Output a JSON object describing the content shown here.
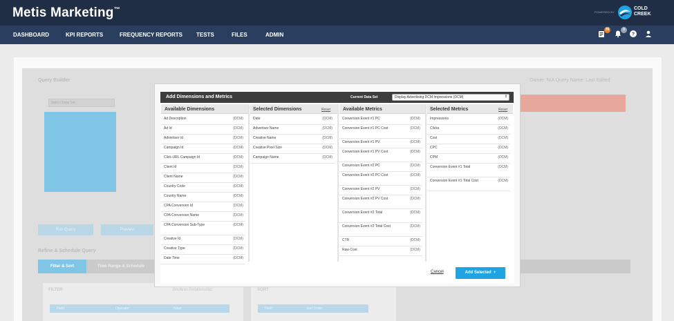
{
  "header": {
    "brand": "Metis Marketing",
    "brand_mark": "™",
    "powered_by": "POWERED BY",
    "partner_name_line1": "COLD",
    "partner_name_line2": "CREEK",
    "notifications_count": "39",
    "alerts_count": "0"
  },
  "nav": {
    "items": [
      "DASHBOARD",
      "KPI REPORTS",
      "FREQUENCY REPORTS",
      "TESTS",
      "FILES",
      "ADMIN"
    ]
  },
  "background": {
    "query_builder_title": "Query Builder",
    "owner_text": "Owner: N/A  Query Name:  Last Edited:",
    "data_set_placeholder": "Select Data Set...",
    "button_1": "Run Query",
    "button_2": "Preview",
    "refine_title": "Refine & Schedule Query",
    "tab_filter_sort": "Filter & Sort",
    "tab_time_range": "Time Range & Schedule",
    "filter_label": "FILTER",
    "boolean_label": "Boolean Relationship:",
    "sort_label": "SORT",
    "filter_cols": [
      "Field",
      "Operator",
      "Value"
    ],
    "sort_cols": [
      "Field",
      "Sort Order"
    ]
  },
  "modal": {
    "title": "Add Dimensions and Metrics",
    "current_data_set_label": "Current Data Set",
    "current_data_set_value": "Display Advertising DCM Impressions (DCM)",
    "reset_label": "Reset",
    "cancel_label": "Cancel",
    "add_selected_label": "Add Selected",
    "add_selected_icon": "plus-icon",
    "available_dimensions": {
      "title": "Available Dimensions",
      "items": [
        {
          "name": "Ad Description",
          "tag": "(DCM)"
        },
        {
          "name": "Ad Id",
          "tag": "(DCM)"
        },
        {
          "name": "Advertiser Id",
          "tag": "(DCM)"
        },
        {
          "name": "Campaign Id",
          "tag": "(DCM)"
        },
        {
          "name": "Click-URL Campaign Id",
          "tag": "(DCM)"
        },
        {
          "name": "Client Id",
          "tag": "(DCM)"
        },
        {
          "name": "Client Name",
          "tag": "(DCM)"
        },
        {
          "name": "Country Code",
          "tag": "(DCM)"
        },
        {
          "name": "Country Name",
          "tag": "(DCM)"
        },
        {
          "name": "CPA Conversion Id",
          "tag": "(DCM)"
        },
        {
          "name": "CPA Conversion Name",
          "tag": "(DCM)"
        },
        {
          "name": "CPA Conversion Sub-Type",
          "tag": "(DCM)"
        },
        {
          "name": "Creative Id",
          "tag": "(DCM)"
        },
        {
          "name": "Creative Type",
          "tag": "(DCM)"
        },
        {
          "name": "Date Time",
          "tag": "(DCM)"
        }
      ]
    },
    "selected_dimensions": {
      "title": "Selected Dimensions",
      "items": [
        {
          "name": "Date",
          "tag": "(DCM)"
        },
        {
          "name": "Advertiser Name",
          "tag": "(DCM)"
        },
        {
          "name": "Creative Name",
          "tag": "(DCM)"
        },
        {
          "name": "Creative Pixel Size",
          "tag": "(DCM)"
        },
        {
          "name": "Campaign Name",
          "tag": "(DCM)"
        }
      ]
    },
    "available_metrics": {
      "title": "Available Metrics",
      "items": [
        {
          "name": "Conversion Event #1 PC",
          "tag": "(DCM)"
        },
        {
          "name": "Conversion Event #1 PC Cost",
          "tag": "(DCM)"
        },
        {
          "name": "Conversion Event #1 PV",
          "tag": "(DCM)"
        },
        {
          "name": "Conversion Event #1 PV Cost",
          "tag": "(DCM)"
        },
        {
          "name": "Conversion Event #2 PC",
          "tag": "(DCM)"
        },
        {
          "name": "Conversion Event #2 PC Cost",
          "tag": "(DCM)"
        },
        {
          "name": "Conversion Event #2 PV",
          "tag": "(DCM)"
        },
        {
          "name": "Conversion Event #2 PV Cost",
          "tag": "(DCM)"
        },
        {
          "name": "Conversion Event #2 Total",
          "tag": "(DCM)"
        },
        {
          "name": "Conversion Event #2 Total Cost",
          "tag": "(DCM)"
        },
        {
          "name": "CTR",
          "tag": "(DCM)"
        },
        {
          "name": "Raw Cost",
          "tag": "(DCM)"
        }
      ]
    },
    "selected_metrics": {
      "title": "Selected Metrics",
      "items": [
        {
          "name": "Impressions",
          "tag": "(DCM)"
        },
        {
          "name": "Clicks",
          "tag": "(DCM)"
        },
        {
          "name": "Cost",
          "tag": "(DCM)"
        },
        {
          "name": "CPC",
          "tag": "(DCM)"
        },
        {
          "name": "CPM",
          "tag": "(DCM)"
        },
        {
          "name": "Conversion Event #1 Total",
          "tag": "(DCM)"
        },
        {
          "name": "Conversion Event #1 Total Cost",
          "tag": "(DCM)"
        }
      ]
    }
  },
  "colors": {
    "header_bg": "#1f2d45",
    "nav_bg": "#2a3f5f",
    "accent_blue": "#1fa3e3",
    "badge_orange": "#e8832f"
  }
}
